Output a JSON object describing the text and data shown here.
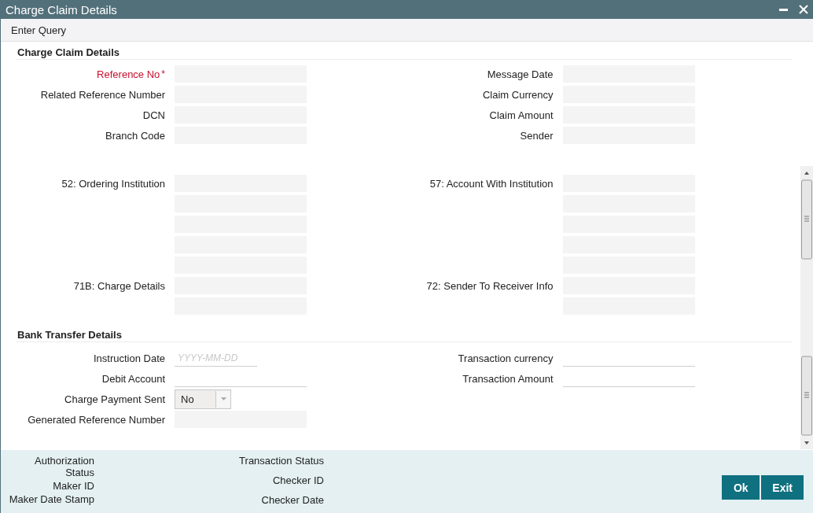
{
  "window": {
    "title": "Charge Claim Details"
  },
  "toolbar": {
    "items": [
      "Enter Query"
    ]
  },
  "sections": [
    {
      "title": "Charge Claim Details",
      "groups": [
        {
          "left": [
            {
              "kind": "readonly",
              "label": "Reference No",
              "required": true,
              "required_mark": "*"
            },
            {
              "kind": "readonly",
              "label": "Related Reference Number",
              "required": false
            },
            {
              "kind": "readonly",
              "label": "DCN",
              "required": false
            },
            {
              "kind": "readonly",
              "label": "Branch Code",
              "required": false
            }
          ],
          "right": [
            {
              "kind": "readonly",
              "label": "Message Date",
              "required": false
            },
            {
              "kind": "readonly",
              "label": "Claim Currency",
              "required": false
            },
            {
              "kind": "readonly",
              "label": "Claim Amount",
              "required": false
            },
            {
              "kind": "readonly",
              "label": "Sender",
              "required": false
            }
          ]
        },
        {
          "left": [
            {
              "kind": "readonly",
              "label": "52: Ordering Institution",
              "required": false
            },
            {
              "kind": "readonly"
            },
            {
              "kind": "readonly"
            },
            {
              "kind": "readonly"
            },
            {
              "kind": "readonly"
            },
            {
              "kind": "readonly",
              "label": "71B: Charge Details",
              "required": false
            },
            {
              "kind": "readonly"
            }
          ],
          "right": [
            {
              "kind": "readonly",
              "label": "57: Account With Institution",
              "required": false
            },
            {
              "kind": "readonly"
            },
            {
              "kind": "readonly"
            },
            {
              "kind": "readonly"
            },
            {
              "kind": "readonly"
            },
            {
              "kind": "readonly",
              "label": "72: Sender To Receiver Info",
              "required": false
            },
            {
              "kind": "readonly"
            }
          ]
        }
      ]
    },
    {
      "title": "Bank Transfer Details",
      "groups": [
        {
          "left": [
            {
              "kind": "date",
              "label": "Instruction Date",
              "required": false,
              "placeholder": "YYYY-MM-DD"
            },
            {
              "kind": "input",
              "label": "Debit Account",
              "required": false
            },
            {
              "kind": "select",
              "label": "Charge Payment Sent",
              "required": false,
              "value": "No"
            },
            {
              "kind": "readonly",
              "label": "Generated Reference Number",
              "required": false
            }
          ],
          "right": [
            {
              "kind": "input",
              "label": "Transaction currency",
              "required": false
            },
            {
              "kind": "input",
              "label": "Transaction Amount",
              "required": false
            }
          ]
        }
      ]
    }
  ],
  "footer": {
    "left": [
      "Authorization Status",
      "Maker ID",
      "Maker Date Stamp"
    ],
    "middle": [
      "Transaction Status",
      "Checker ID",
      "Checker Date"
    ],
    "buttons": [
      "Ok",
      "Exit"
    ]
  }
}
